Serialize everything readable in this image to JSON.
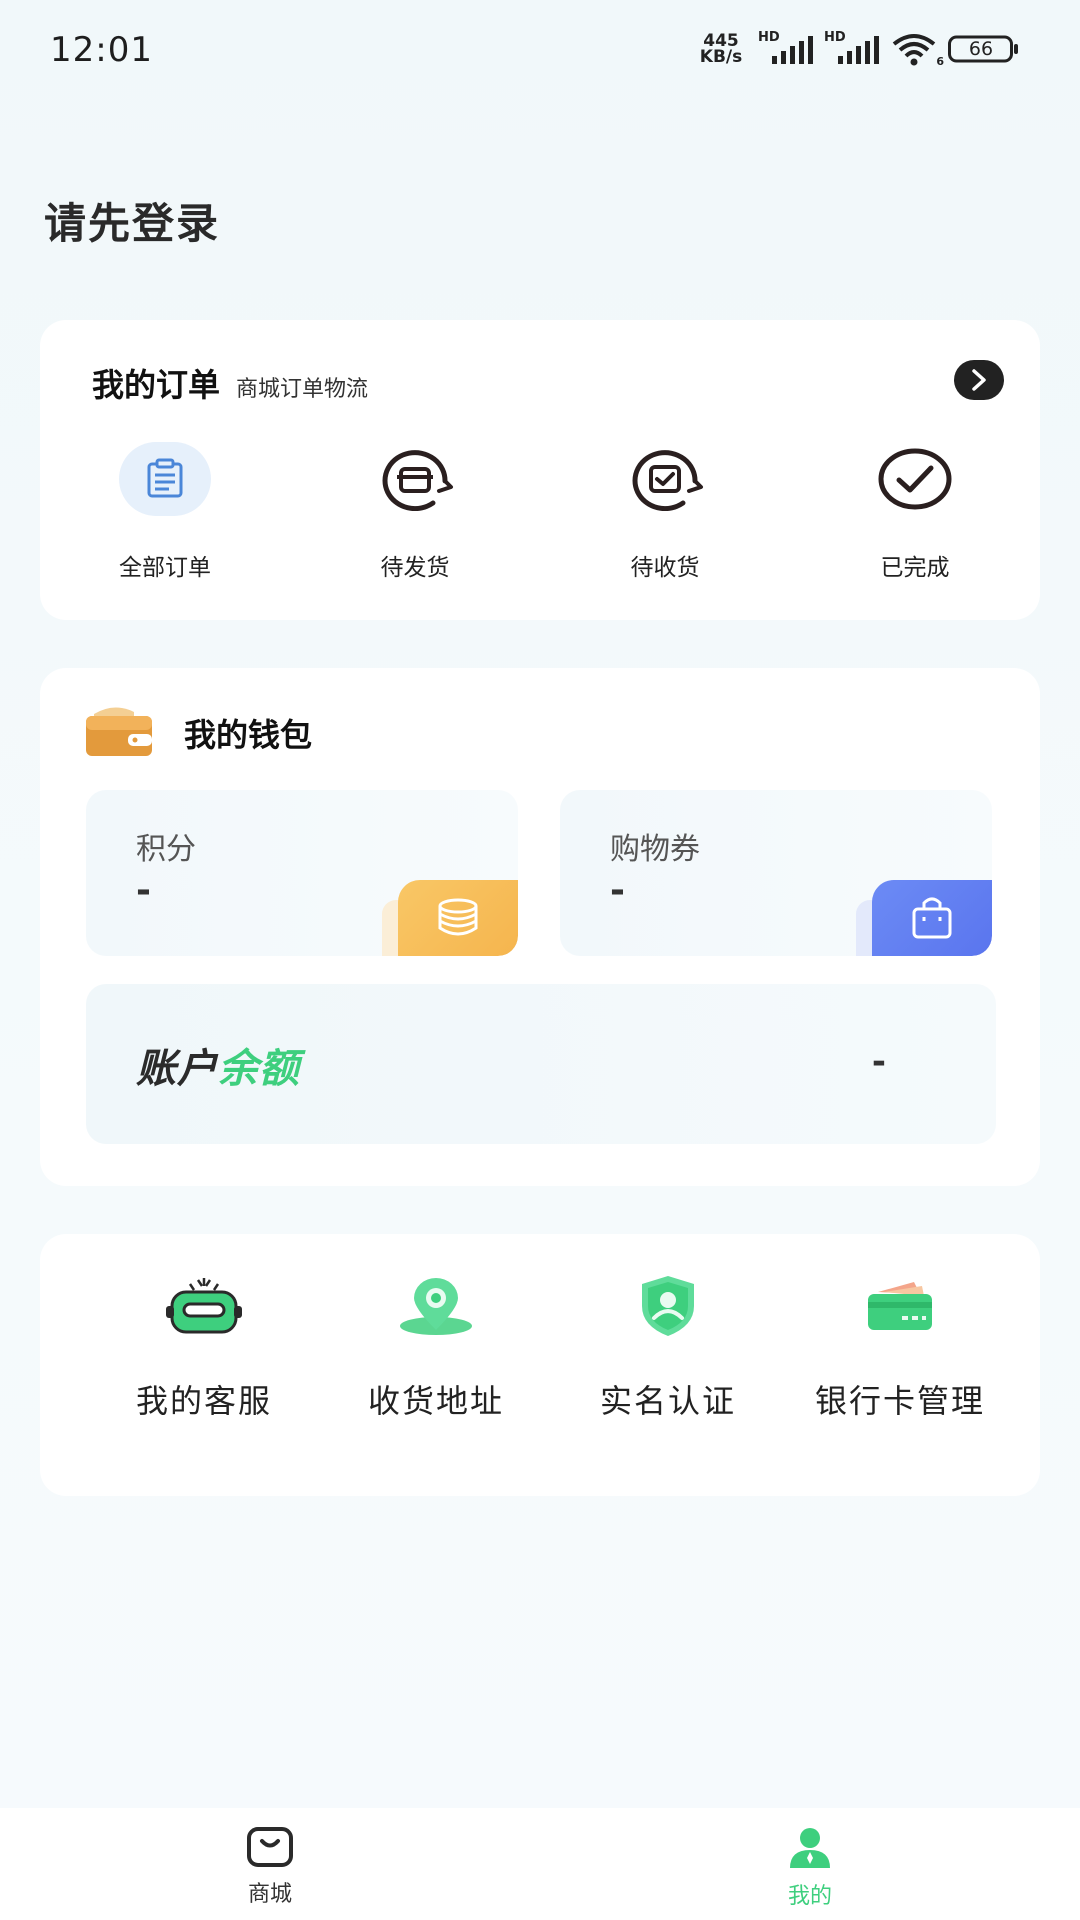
{
  "status_bar": {
    "time": "12:01",
    "net_speed_value": "445",
    "net_speed_unit": "KB/s",
    "sim1_label": "HD",
    "sim2_label": "HD",
    "wifi_label": "6",
    "battery": "66"
  },
  "page": {
    "login_prompt": "请先登录"
  },
  "orders": {
    "title": "我的订单",
    "subtitle": "商城订单物流",
    "items": [
      {
        "label": "全部订单",
        "icon": "document-icon"
      },
      {
        "label": "待发货",
        "icon": "box-pending-ship-icon"
      },
      {
        "label": "待收货",
        "icon": "box-pending-receive-icon"
      },
      {
        "label": "已完成",
        "icon": "check-circle-icon"
      }
    ]
  },
  "wallet": {
    "title": "我的钱包",
    "points_label": "积分",
    "points_value": "-",
    "coupon_label": "购物券",
    "coupon_value": "-",
    "balance_title_part1": "账户",
    "balance_title_part2": "余额",
    "balance_value": "-"
  },
  "services": {
    "items": [
      {
        "label": "我的客服",
        "icon": "robot-icon"
      },
      {
        "label": "收货地址",
        "icon": "location-pin-icon"
      },
      {
        "label": "实名认证",
        "icon": "shield-user-icon"
      },
      {
        "label": "银行卡管理",
        "icon": "bank-card-icon"
      }
    ]
  },
  "tabbar": {
    "items": [
      {
        "label": "商城",
        "icon": "shop-bag-icon",
        "active": false
      },
      {
        "label": "我的",
        "icon": "person-icon",
        "active": true
      }
    ]
  },
  "colors": {
    "accent_green": "#3ecf7e",
    "gold": "#f5b54e",
    "blue": "#5a75ee",
    "background": "#f4f9fb"
  }
}
